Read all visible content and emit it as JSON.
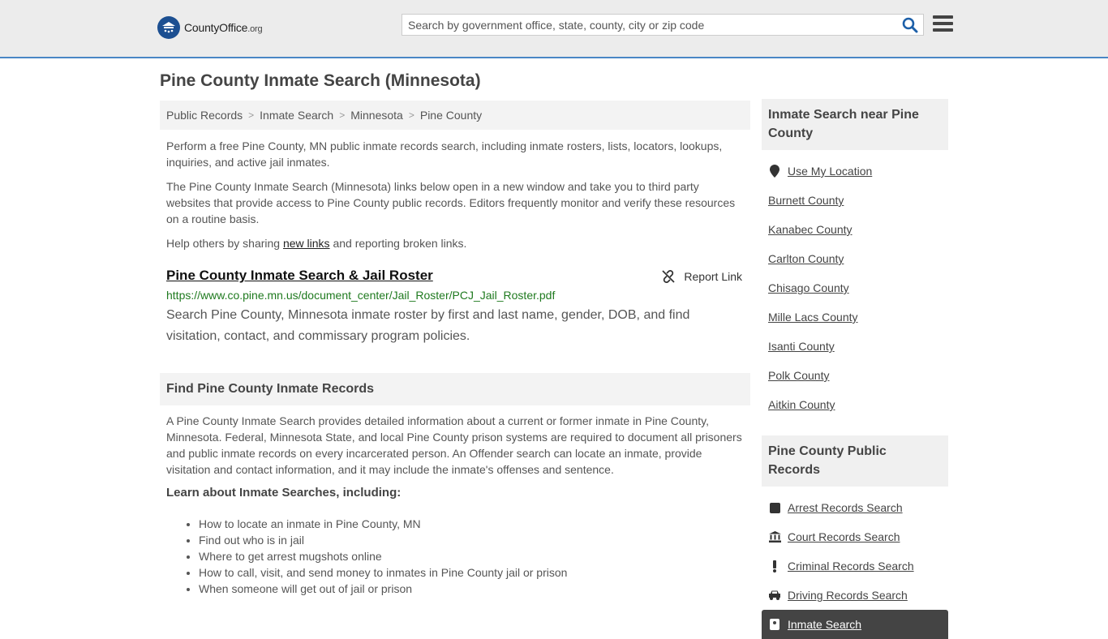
{
  "header": {
    "logo_text": "CountyOffice",
    "logo_suffix": ".org",
    "search_placeholder": "Search by government office, state, county, city or zip code"
  },
  "page_title": "Pine County Inmate Search (Minnesota)",
  "breadcrumb": [
    "Public Records",
    "Inmate Search",
    "Minnesota",
    "Pine County"
  ],
  "intro": {
    "p1": "Perform a free Pine County, MN public inmate records search, including inmate rosters, lists, locators, lookups, inquiries, and active jail inmates.",
    "p2": "The Pine County Inmate Search (Minnesota) links below open in a new window and take you to third party websites that provide access to Pine County public records. Editors frequently monitor and verify these resources on a routine basis.",
    "p3_before": "Help others by sharing ",
    "p3_link": "new links",
    "p3_after": " and reporting broken links."
  },
  "result": {
    "title": "Pine County Inmate Search & Jail Roster",
    "report_label": "Report Link",
    "url": "https://www.co.pine.mn.us/document_center/Jail_Roster/PCJ_Jail_Roster.pdf",
    "description": "Search Pine County, Minnesota inmate roster by first and last name, gender, DOB, and find visitation, contact, and commissary program policies."
  },
  "find_section": {
    "heading": "Find Pine County Inmate Records",
    "body": "A Pine County Inmate Search provides detailed information about a current or former inmate in Pine County, Minnesota. Federal, Minnesota State, and local Pine County prison systems are required to document all prisoners and public inmate records on every incarcerated person. An Offender search can locate an inmate, provide visitation and contact information, and it may include the inmate's offenses and sentence.",
    "learn_heading": "Learn about Inmate Searches, including:",
    "bullets": [
      "How to locate an inmate in Pine County, MN",
      "Find out who is in jail",
      "Where to get arrest mugshots online",
      "How to call, visit, and send money to inmates in Pine County jail or prison",
      "When someone will get out of jail or prison"
    ]
  },
  "sidebar": {
    "nearby_heading": "Inmate Search near Pine County",
    "use_location": "Use My Location",
    "nearby": [
      "Burnett County",
      "Kanabec County",
      "Carlton County",
      "Chisago County",
      "Mille Lacs County",
      "Isanti County",
      "Polk County",
      "Aitkin County"
    ],
    "records_heading": "Pine County Public Records",
    "records": [
      {
        "label": "Arrest Records Search",
        "icon": "square-icon"
      },
      {
        "label": "Court Records Search",
        "icon": "courthouse-icon"
      },
      {
        "label": "Criminal Records Search",
        "icon": "exclamation-icon"
      },
      {
        "label": "Driving Records Search",
        "icon": "car-icon"
      },
      {
        "label": "Inmate Search",
        "icon": "inmate-icon"
      }
    ]
  },
  "colors": {
    "accent": "#4a86c5",
    "logo_blue": "#1c4f91",
    "url_green": "#1f7a1f",
    "active_bg": "#444444"
  }
}
